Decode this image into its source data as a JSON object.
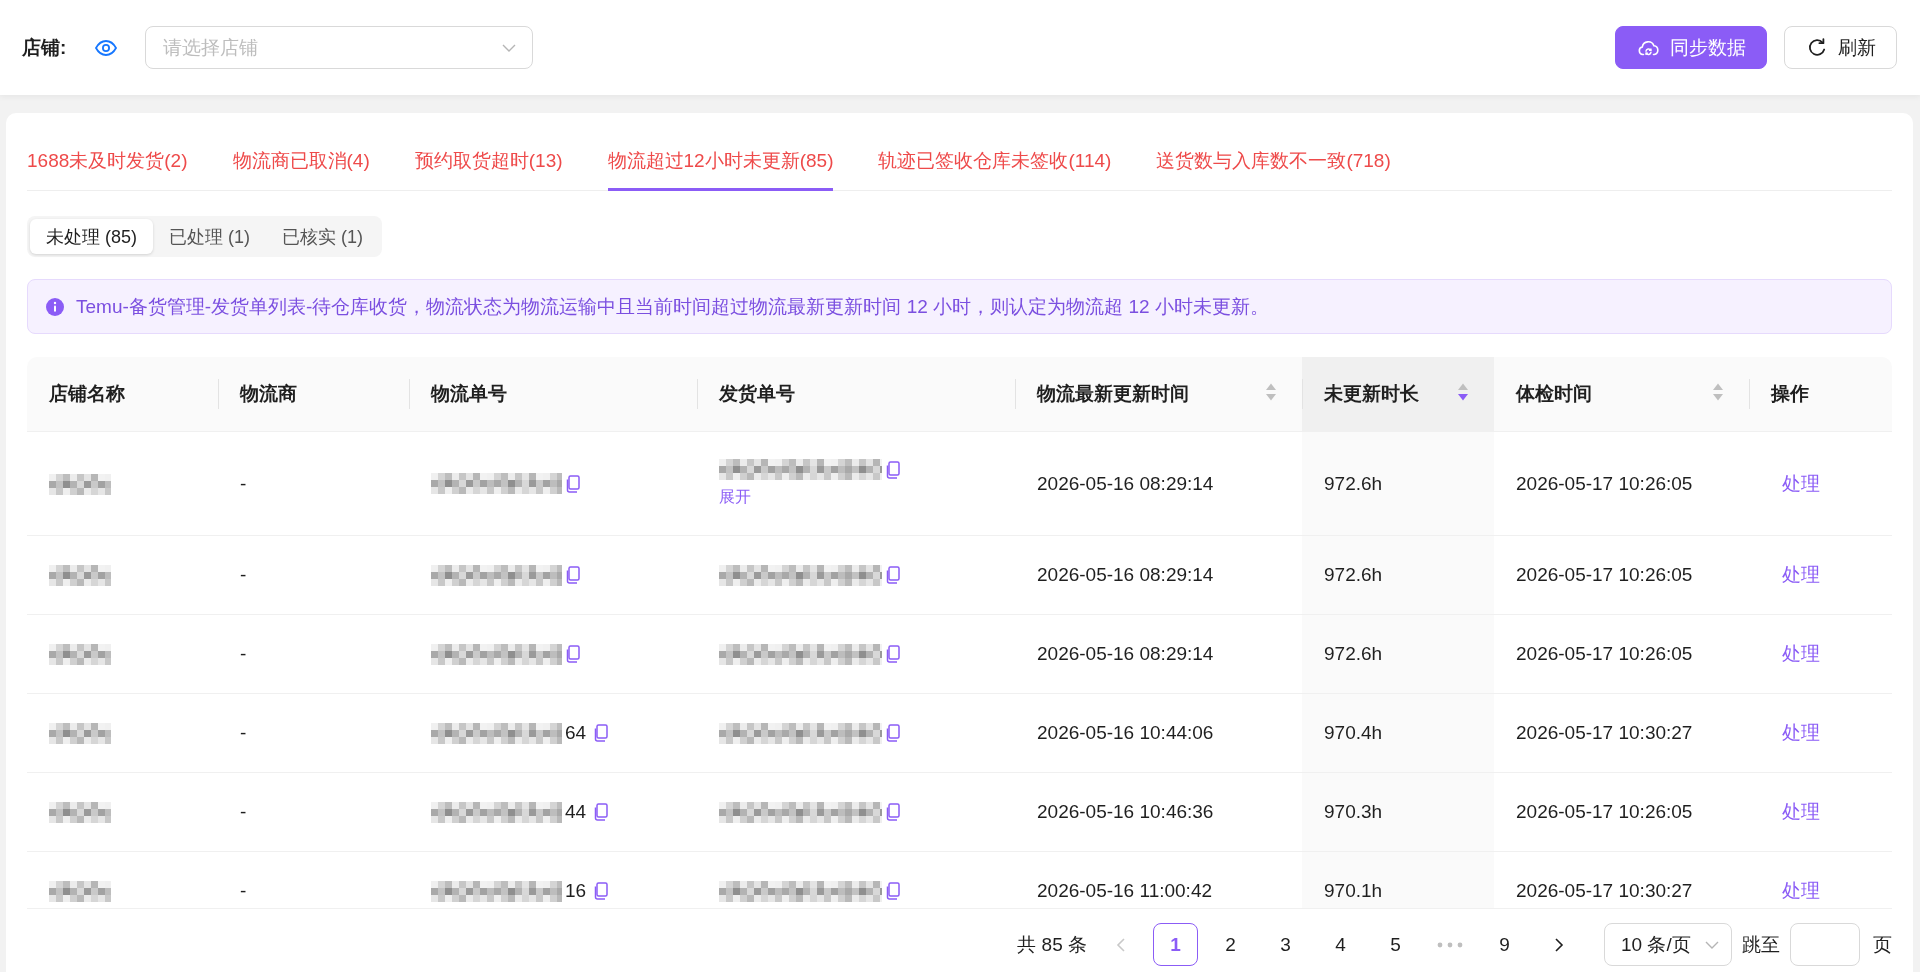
{
  "top_bar": {
    "store_label": "店铺:",
    "store_select": {
      "placeholder": "请选择店铺"
    },
    "buttons": [
      {
        "kind": "sync",
        "label": "同步数据"
      },
      {
        "kind": "refresh",
        "label": "刷新"
      }
    ]
  },
  "tabs": [
    {
      "label": "1688未及时发货(2)",
      "selected": false
    },
    {
      "label": "物流商已取消(4)",
      "selected": false
    },
    {
      "label": "预约取货超时(13)",
      "selected": false
    },
    {
      "label": "物流超过12小时未更新(85)",
      "selected": true
    },
    {
      "label": "轨迹已签收仓库未签收(114)",
      "selected": false
    },
    {
      "label": "送货数与入库数不一致(718)",
      "selected": false
    }
  ],
  "status_filter": [
    {
      "label": "未处理 (85)",
      "selected": true
    },
    {
      "label": "已处理 (1)",
      "selected": false
    },
    {
      "label": "已核实 (1)",
      "selected": false
    }
  ],
  "alert": {
    "text": "Temu-备货管理-发货单列表-待仓库收货，物流状态为物流运输中且当前时间超过物流最新更新时间 12 小时，则认定为物流超 12 小时未更新。"
  },
  "table": {
    "columns": [
      {
        "title": "店铺名称",
        "kind": "masked"
      },
      {
        "title": "物流商",
        "kind": "text"
      },
      {
        "title": "物流单号",
        "kind": "copyable"
      },
      {
        "title": "发货单号",
        "kind": "copyable"
      },
      {
        "title": "物流最新更新时间",
        "kind": "text",
        "sort_asc": false,
        "sort_desc": false
      },
      {
        "title": "未更新时长",
        "kind": "text",
        "sort_asc": false,
        "sort_desc": true
      },
      {
        "title": "体检时间",
        "kind": "text",
        "sort_asc": false,
        "sort_desc": false
      },
      {
        "title": "操作",
        "kind": "action"
      }
    ],
    "rows": [
      {
        "cells": [
          {
            "redacted": true
          },
          {
            "text": "-"
          },
          {
            "redacted": true
          },
          {
            "redacted": true,
            "link": "展开"
          },
          {
            "text": "2026-05-16 08:29:14"
          },
          {
            "text": "972.6h"
          },
          {
            "text": "2026-05-17 10:26:05"
          },
          {
            "text": "处理"
          }
        ]
      },
      {
        "cells": [
          {
            "redacted": true
          },
          {
            "text": "-"
          },
          {
            "redacted": true
          },
          {
            "redacted": true
          },
          {
            "text": "2026-05-16 08:29:14"
          },
          {
            "text": "972.6h"
          },
          {
            "text": "2026-05-17 10:26:05"
          },
          {
            "text": "处理"
          }
        ]
      },
      {
        "cells": [
          {
            "redacted": true
          },
          {
            "text": "-"
          },
          {
            "redacted": true
          },
          {
            "redacted": true
          },
          {
            "text": "2026-05-16 08:29:14"
          },
          {
            "text": "972.6h"
          },
          {
            "text": "2026-05-17 10:26:05"
          },
          {
            "text": "处理"
          }
        ]
      },
      {
        "cells": [
          {
            "redacted": true
          },
          {
            "text": "-"
          },
          {
            "redacted": true,
            "text": "64"
          },
          {
            "redacted": true
          },
          {
            "text": "2026-05-16 10:44:06"
          },
          {
            "text": "970.4h"
          },
          {
            "text": "2026-05-17 10:30:27"
          },
          {
            "text": "处理"
          }
        ]
      },
      {
        "cells": [
          {
            "redacted": true
          },
          {
            "text": "-"
          },
          {
            "redacted": true,
            "text": "44"
          },
          {
            "redacted": true
          },
          {
            "text": "2026-05-16 10:46:36"
          },
          {
            "text": "970.3h"
          },
          {
            "text": "2026-05-17 10:26:05"
          },
          {
            "text": "处理"
          }
        ]
      },
      {
        "cells": [
          {
            "redacted": true
          },
          {
            "text": "-"
          },
          {
            "redacted": true,
            "text": "16"
          },
          {
            "redacted": true
          },
          {
            "text": "2026-05-16 11:00:42"
          },
          {
            "text": "970.1h"
          },
          {
            "text": "2026-05-17 10:30:27"
          },
          {
            "text": "处理"
          }
        ]
      }
    ]
  },
  "pagination": {
    "total": "共 85 条",
    "prev": {
      "disabled": true
    },
    "pages": [
      {
        "kind": "page",
        "label": "1",
        "selected": true
      },
      {
        "kind": "page",
        "label": "2",
        "selected": false
      },
      {
        "kind": "page",
        "label": "3",
        "selected": false
      },
      {
        "kind": "page",
        "label": "4",
        "selected": false
      },
      {
        "kind": "page",
        "label": "5",
        "selected": false
      },
      {
        "kind": "ellipsis"
      },
      {
        "kind": "page",
        "label": "9",
        "selected": false
      }
    ],
    "next": {
      "disabled": false
    },
    "page_size": {
      "value": "10 条/页"
    },
    "jump": {
      "label": "跳至",
      "suffix": "页"
    }
  }
}
